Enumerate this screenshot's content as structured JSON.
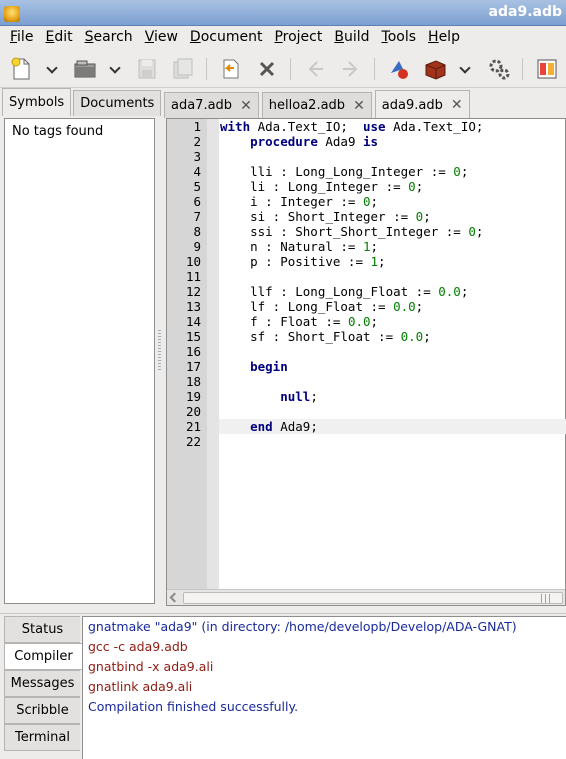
{
  "window": {
    "title": "ada9.adb"
  },
  "menu": [
    {
      "key": "F",
      "rest": "ile"
    },
    {
      "key": "E",
      "rest": "dit"
    },
    {
      "key": "S",
      "rest": "earch"
    },
    {
      "key": "V",
      "rest": "iew"
    },
    {
      "key": "D",
      "rest": "ocument"
    },
    {
      "key": "P",
      "rest": "roject"
    },
    {
      "key": "B",
      "rest": "uild"
    },
    {
      "key": "T",
      "rest": "ools"
    },
    {
      "key": "H",
      "rest": "elp"
    }
  ],
  "left_panel": {
    "tabs": [
      "Symbols",
      "Documents"
    ],
    "active_tab": "Symbols",
    "empty_message": "No tags found"
  },
  "editor": {
    "tabs": [
      "ada7.adb",
      "helloa2.adb",
      "ada9.adb"
    ],
    "active_tab": "ada9.adb",
    "current_line": 21,
    "lines": [
      "with Ada.Text_IO;  use Ada.Text_IO;",
      "    procedure Ada9 is",
      "",
      "    lli : Long_Long_Integer := 0;",
      "    li : Long_Integer := 0;",
      "    i : Integer := 0;",
      "    si : Short_Integer := 0;",
      "    ssi : Short_Short_Integer := 0;",
      "    n : Natural := 1;",
      "    p : Positive := 1;",
      "",
      "    llf : Long_Long_Float := 0.0;",
      "    lf : Long_Float := 0.0;",
      "    f : Float := 0.0;",
      "    sf : Short_Float := 0.0;",
      "",
      "    begin",
      "",
      "        null;",
      "",
      "    end Ada9;",
      ""
    ],
    "keywords": [
      "with",
      "use",
      "procedure",
      "is",
      "begin",
      "null",
      "end"
    ]
  },
  "bottom_panel": {
    "tabs": [
      "Status",
      "Compiler",
      "Messages",
      "Scribble",
      "Terminal"
    ],
    "active_tab": "Compiler",
    "messages": [
      {
        "text": "gnatmake \"ada9\" (in directory: /home/developb/Develop/ADA-GNAT)",
        "color": "#1a2a9a"
      },
      {
        "text": "gcc -c ada9.adb",
        "color": "#8c1c12"
      },
      {
        "text": "gnatbind -x ada9.ali",
        "color": "#8c1c12"
      },
      {
        "text": "gnatlink ada9.ali",
        "color": "#8c1c12"
      },
      {
        "text": "Compilation finished successfully.",
        "color": "#1a2a9a"
      }
    ]
  },
  "toolbar": {
    "icons": [
      "new-file-icon",
      "open-file-icon",
      "save-icon",
      "save-all-icon",
      "revert-icon",
      "close-icon",
      "back-icon",
      "forward-icon",
      "compile-icon",
      "build-icon",
      "execute-icon",
      "preferences-icon"
    ]
  }
}
